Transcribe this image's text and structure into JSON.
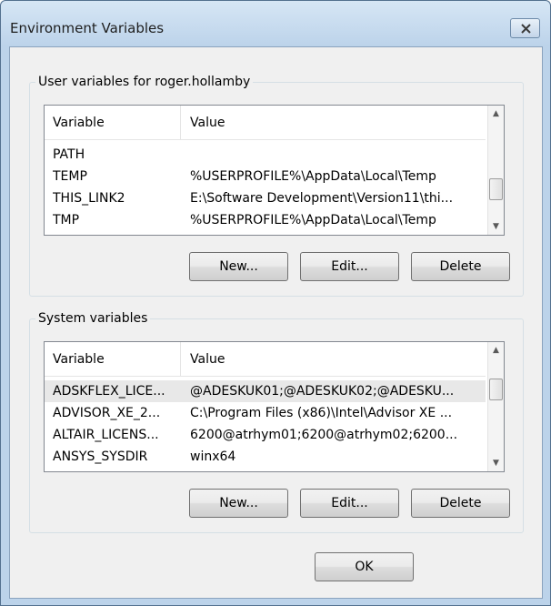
{
  "window": {
    "title": "Environment Variables"
  },
  "user_group": {
    "label": "User variables for roger.hollamby",
    "columns": [
      "Variable",
      "Value"
    ],
    "rows": [
      {
        "variable": "PATH",
        "value": ""
      },
      {
        "variable": "TEMP",
        "value": "%USERPROFILE%\\AppData\\Local\\Temp"
      },
      {
        "variable": "THIS_LINK2",
        "value": "E:\\Software Development\\Version11\\thi..."
      },
      {
        "variable": "TMP",
        "value": "%USERPROFILE%\\AppData\\Local\\Temp"
      }
    ],
    "buttons": {
      "new": "New...",
      "edit": "Edit...",
      "delete": "Delete"
    }
  },
  "system_group": {
    "label": "System variables",
    "columns": [
      "Variable",
      "Value"
    ],
    "rows": [
      {
        "variable": "ADSKFLEX_LICE...",
        "value": "@ADESKUK01;@ADESKUK02;@ADESKU..."
      },
      {
        "variable": "ADVISOR_XE_2...",
        "value": "C:\\Program Files (x86)\\Intel\\Advisor XE ..."
      },
      {
        "variable": "ALTAIR_LICENS...",
        "value": "6200@atrhym01;6200@atrhym02;6200..."
      },
      {
        "variable": "ANSYS_SYSDIR",
        "value": "winx64"
      }
    ],
    "buttons": {
      "new": "New...",
      "edit": "Edit...",
      "delete": "Delete"
    }
  },
  "footer": {
    "ok": "OK"
  },
  "icons": {
    "close": "close-icon",
    "scroll_up": "scroll-up-arrow-icon",
    "scroll_down": "scroll-down-arrow-icon"
  }
}
